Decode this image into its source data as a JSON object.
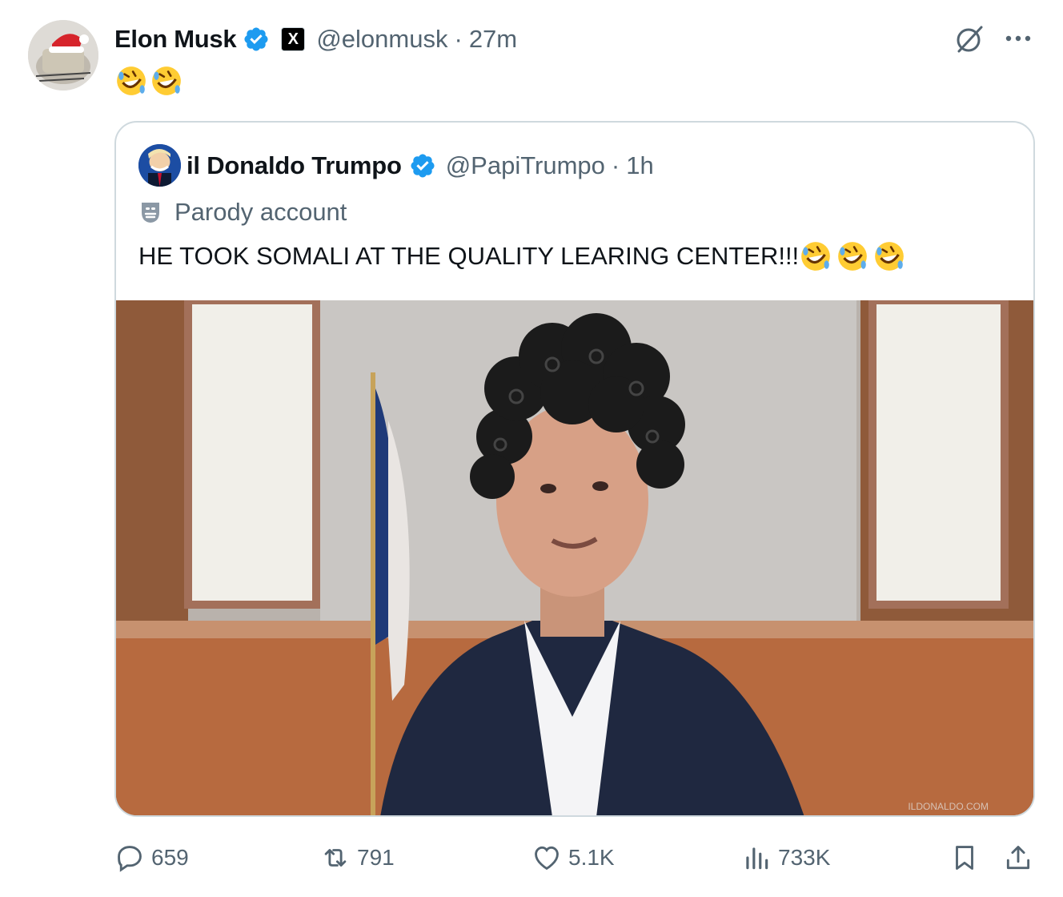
{
  "post": {
    "author": {
      "display_name": "Elon Musk",
      "handle": "@elonmusk",
      "time": "27m",
      "separator": "·",
      "verified": true,
      "affiliate_badge": "X",
      "avatar_icon": "santa-hat-avatar"
    },
    "text_emojis": [
      "rolling-on-floor-laughing",
      "rolling-on-floor-laughing"
    ],
    "quoted": {
      "display_name": "il Donaldo Trumpo",
      "handle": "@PapiTrumpo",
      "time": "1h",
      "separator": "·",
      "verified": true,
      "parody_label": "Parody account",
      "text": "HE TOOK SOMALI AT THE QUALITY LEARING CENTER!!!",
      "text_emojis": [
        "rolling-on-floor-laughing",
        "rolling-on-floor-laughing",
        "rolling-on-floor-laughing"
      ],
      "media_watermark": "ILDONALDO.COM"
    },
    "actions": {
      "replies": "659",
      "reposts": "791",
      "likes": "5.1K",
      "views": "733K"
    }
  },
  "icons": {
    "grok": "grok-icon",
    "more": "more-icon",
    "reply": "reply-icon",
    "repost": "repost-icon",
    "like": "heart-icon",
    "views": "views-chart-icon",
    "bookmark": "bookmark-icon",
    "share": "share-icon",
    "parody": "theater-mask-icon"
  },
  "colors": {
    "verified_blue": "#1d9bf0",
    "secondary_text": "#536471",
    "border": "#cfd9de",
    "text": "#0f1419"
  }
}
